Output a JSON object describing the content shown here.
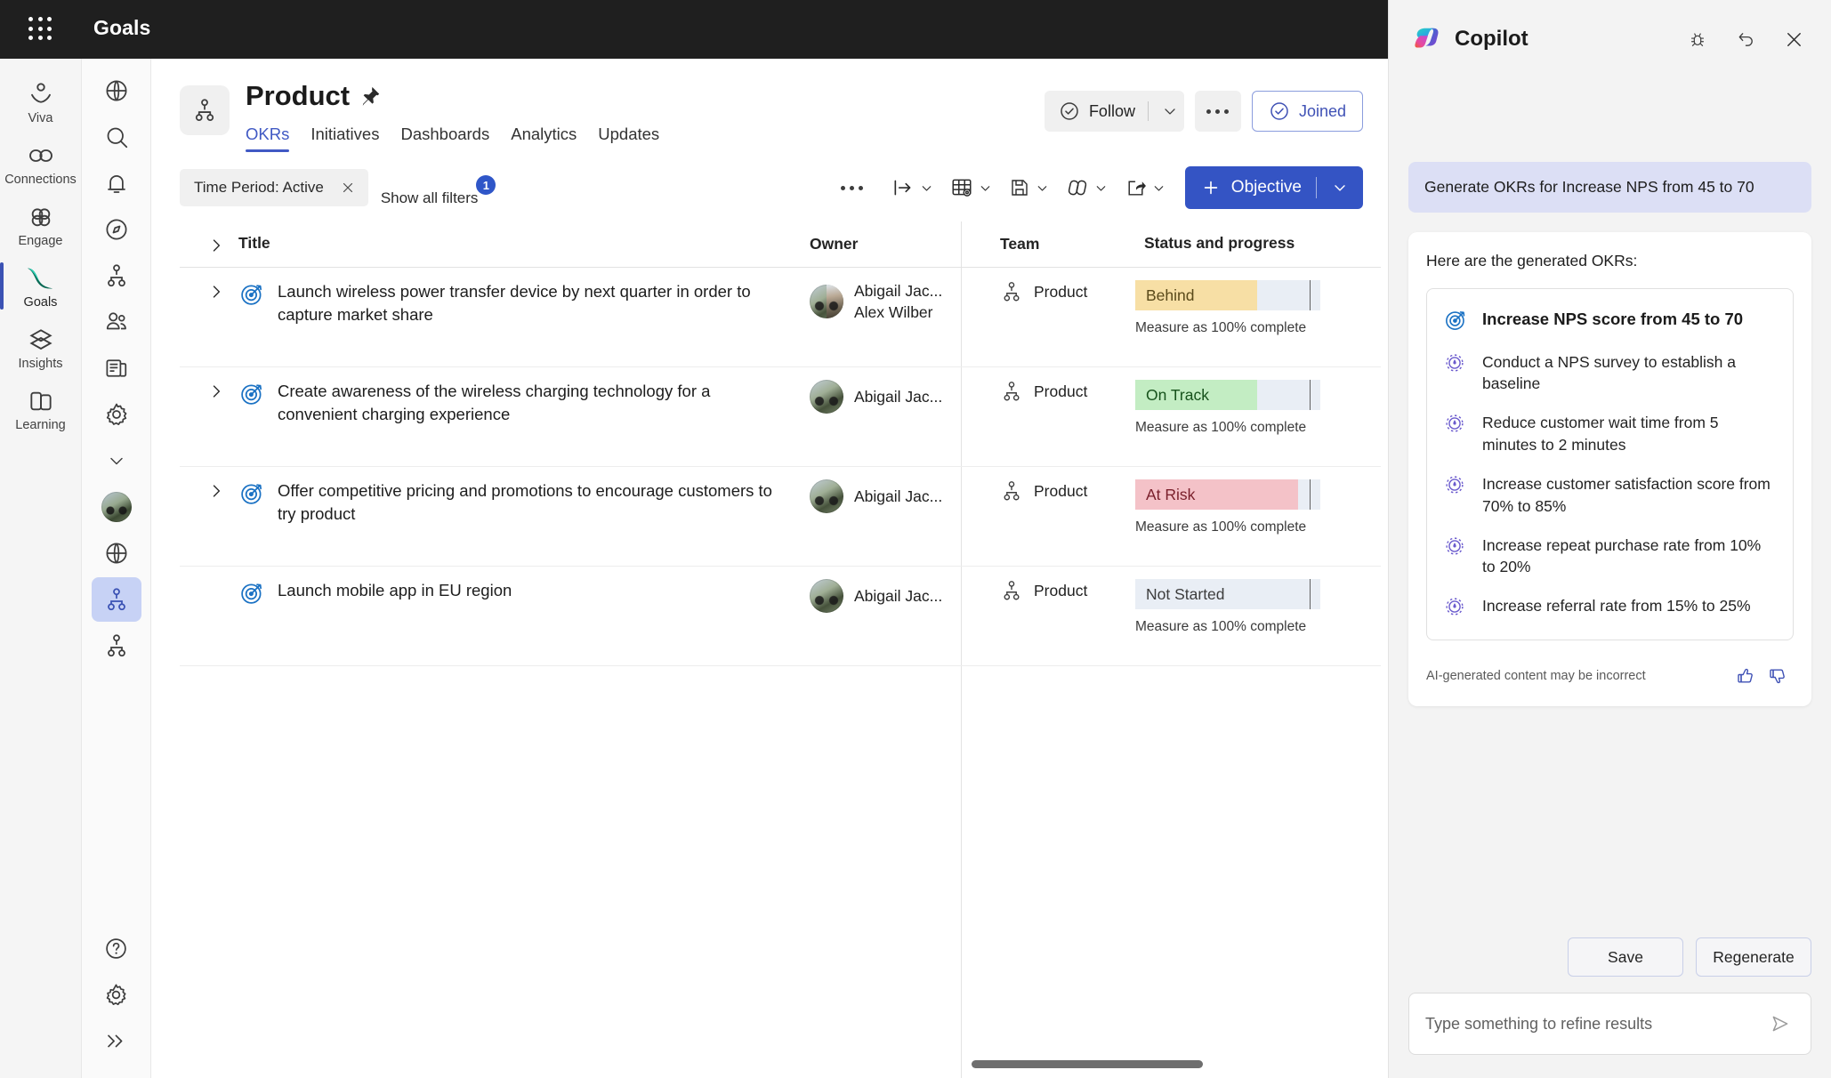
{
  "app": {
    "title": "Goals",
    "waffle_icon": "app-launcher-icon"
  },
  "rail": {
    "items": [
      {
        "label": "Viva",
        "icon": "viva-icon",
        "active": false
      },
      {
        "label": "Connections",
        "icon": "connections-icon",
        "active": false
      },
      {
        "label": "Engage",
        "icon": "engage-icon",
        "active": false
      },
      {
        "label": "Goals",
        "icon": "goals-icon",
        "active": true
      },
      {
        "label": "Insights",
        "icon": "insights-icon",
        "active": false
      },
      {
        "label": "Learning",
        "icon": "learning-icon",
        "active": false
      }
    ]
  },
  "nav2": {
    "items": [
      {
        "icon": "globe-icon",
        "selected": false
      },
      {
        "icon": "search-icon",
        "selected": false
      },
      {
        "icon": "bell-icon",
        "selected": false
      },
      {
        "icon": "compass-icon",
        "selected": false
      },
      {
        "icon": "org-chart-icon",
        "selected": false
      },
      {
        "icon": "people-icon",
        "selected": false
      },
      {
        "icon": "news-icon",
        "selected": false
      },
      {
        "icon": "gear-icon",
        "selected": false
      },
      {
        "icon": "chevron-down-icon",
        "selected": false
      },
      {
        "icon": "avatar",
        "selected": false
      },
      {
        "icon": "globe-icon",
        "selected": false
      },
      {
        "icon": "org-chart-icon",
        "selected": true
      },
      {
        "icon": "org-chart-icon",
        "selected": false
      }
    ],
    "bottom": [
      {
        "icon": "help-icon"
      },
      {
        "icon": "gear-icon"
      },
      {
        "icon": "expand-icon"
      }
    ]
  },
  "page": {
    "title": "Product",
    "pin_icon": "pin-icon",
    "team_icon": "org-chart-icon",
    "tabs": [
      {
        "label": "OKRs",
        "active": true
      },
      {
        "label": "Initiatives",
        "active": false
      },
      {
        "label": "Dashboards",
        "active": false
      },
      {
        "label": "Analytics",
        "active": false
      },
      {
        "label": "Updates",
        "active": false
      }
    ],
    "actions": {
      "follow_label": "Follow",
      "follow_icon": "check-circle-icon",
      "follow_caret": "chevron-down-icon",
      "more_icon": "ellipsis-icon",
      "joined_label": "Joined",
      "joined_icon": "check-circle-icon"
    }
  },
  "toolbar": {
    "filter_chip": "Time Period: Active",
    "filter_chip_clear": "✕",
    "show_all_filters": "Show all filters",
    "filter_count": "1",
    "overflow_icon": "ellipsis-icon",
    "buttons": [
      {
        "icon": "indent-icon",
        "caret": "chevron-down-icon"
      },
      {
        "icon": "table-settings-icon",
        "caret": "chevron-down-icon"
      },
      {
        "icon": "save-icon",
        "caret": "chevron-down-icon"
      },
      {
        "icon": "align-icon",
        "caret": "chevron-down-icon"
      },
      {
        "icon": "share-icon",
        "caret": "chevron-down-icon"
      }
    ],
    "objective_label": "Objective",
    "objective_plus": "plus-icon",
    "objective_caret": "chevron-down-icon",
    "accent_color": "#3454c4"
  },
  "table": {
    "columns": [
      "Title",
      "Owner",
      "Team",
      "Status and progress"
    ],
    "measure_text": "Measure as 100% complete",
    "rows": [
      {
        "title": "Launch wireless power transfer device by next quarter in order to capture market share",
        "expandable": true,
        "owners": [
          "Abigail Jac...",
          "Alex Wilber"
        ],
        "multi_owner": true,
        "team": "Product",
        "status": "Behind",
        "status_bg": "#f7dfa5",
        "status_text_color": "#5a4a1a",
        "progress_pct": 66,
        "measure": "Measure as 100% complete"
      },
      {
        "title": "Create awareness of the wireless charging technology for a convenient charging experience",
        "expandable": true,
        "owners": [
          "Abigail Jac..."
        ],
        "multi_owner": false,
        "team": "Product",
        "status": "On Track",
        "status_bg": "#c3edc3",
        "status_text_color": "#16521b",
        "progress_pct": 66,
        "measure": "Measure as 100% complete"
      },
      {
        "title": "Offer competitive pricing and promotions to encourage customers to try product",
        "expandable": true,
        "owners": [
          "Abigail Jac..."
        ],
        "multi_owner": false,
        "team": "Product",
        "status": "At Risk",
        "status_bg": "#f4c2c8",
        "status_text_color": "#7a1f2b",
        "progress_pct": 88,
        "measure": "Measure as 100% complete"
      },
      {
        "title": "Launch mobile app in EU region",
        "expandable": false,
        "owners": [
          "Abigail Jac..."
        ],
        "multi_owner": false,
        "team": "Product",
        "status": "Not Started",
        "status_bg": "#e9eef5",
        "status_text_color": "#3d3d3d",
        "progress_pct": 0,
        "measure": "Measure as 100% complete"
      }
    ]
  },
  "copilot": {
    "title": "Copilot",
    "logo_icon": "copilot-icon",
    "header_buttons": [
      {
        "icon": "bug-icon"
      },
      {
        "icon": "undo-icon"
      },
      {
        "icon": "close-icon"
      }
    ],
    "user_message": "Generate OKRs for Increase NPS from 45 to 70",
    "intro": "Here are the generated OKRs:",
    "objective": {
      "icon": "objective-target-icon",
      "text": "Increase NPS score from 45 to 70"
    },
    "key_results": [
      {
        "icon": "key-result-gauge-icon",
        "text": "Conduct a NPS survey to establish a baseline"
      },
      {
        "icon": "key-result-gauge-icon",
        "text": "Reduce customer wait time from 5 minutes to 2 minutes"
      },
      {
        "icon": "key-result-gauge-icon",
        "text": "Increase customer satisfaction score from 70% to 85%"
      },
      {
        "icon": "key-result-gauge-icon",
        "text": "Increase repeat purchase rate from 10% to 20%"
      },
      {
        "icon": "key-result-gauge-icon",
        "text": "Increase referral rate from 15% to 25%"
      }
    ],
    "disclaimer": "AI-generated content may be incorrect",
    "thumbs_up_icon": "thumbs-up-icon",
    "thumbs_down_icon": "thumbs-down-icon",
    "save_label": "Save",
    "regenerate_label": "Regenerate",
    "input_placeholder": "Type something to refine results",
    "send_icon": "send-icon"
  }
}
